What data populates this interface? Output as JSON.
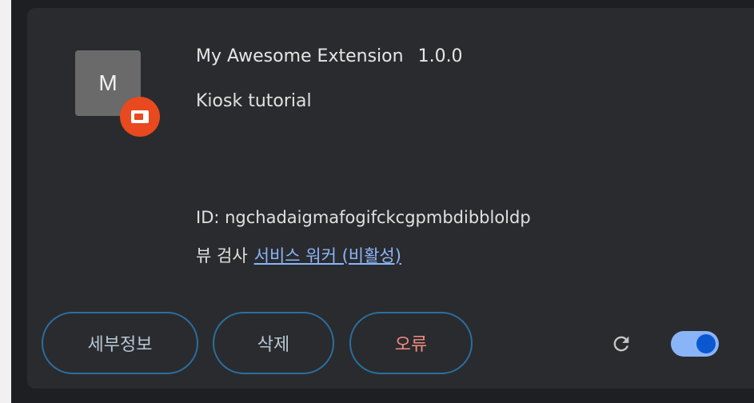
{
  "extension": {
    "icon_letter": "M",
    "name": "My Awesome Extension",
    "version": "1.0.0",
    "description": "Kiosk tutorial",
    "id_text": "ID: ngchadaigmafogifckcgpmbdibbloldp",
    "inspect_label": "뷰 검사",
    "inspect_link": "서비스 워커 (비활성)"
  },
  "actions": {
    "details_label": "세부정보",
    "remove_label": "삭제",
    "errors_label": "오류"
  },
  "controls": {
    "reload_icon": "reload-icon",
    "enabled": true
  },
  "colors": {
    "card_bg": "#2a2b2e",
    "button_border": "#2a6f9f",
    "error_text": "#f28b82",
    "link": "#8ab4f8",
    "toggle_track": "#8ab4f8",
    "toggle_knob": "#0b57d0",
    "badge": "#e8491e"
  }
}
